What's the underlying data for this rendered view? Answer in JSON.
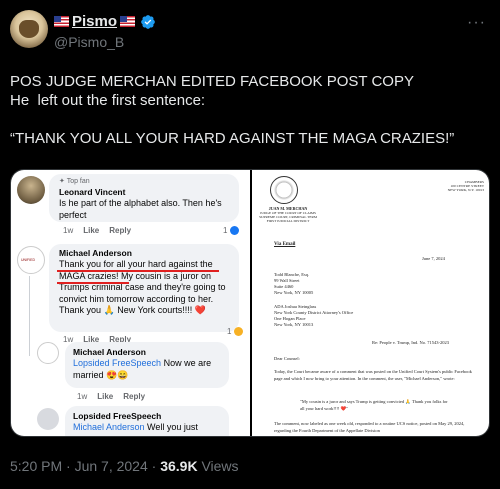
{
  "author": {
    "display_name": "Pismo",
    "handle": "@Pismo_B"
  },
  "more_label": "···",
  "post": {
    "line1": "POS JUDGE MERCHAN EDITED FACEBOOK POST COPY",
    "line2": "He  left out the first sentence:",
    "line3": "“THANK YOU ALL YOUR HARD AGAINST THE MAGA CRAZIES!”"
  },
  "facebook": {
    "comment1": {
      "badge": "Top fan",
      "author": "Leonard Vincent",
      "text": "Is he part of the alphabet also. Then he's perfect",
      "time": "1w",
      "like": "Like",
      "reply": "Reply",
      "count": "1"
    },
    "comment2": {
      "author": "Michael Anderson",
      "text": "Thank you for all your hard against the MAGA crazies! My cousin is a juror on Trumps criminal case and they're going to convict him tomorrow according to her. Thank you 🙏 New York courts!!!! ❤️",
      "time": "1w",
      "like": "Like",
      "reply": "Reply",
      "count": "1"
    },
    "comment3": {
      "author": "Michael Anderson",
      "mention": "Lopsided FreeSpeech",
      "text": " Now we are married 😍😄",
      "time": "1w",
      "like": "Like",
      "reply": "Reply"
    },
    "comment4": {
      "author": "Lopsided FreeSpeech",
      "mention": "Michael Anderson",
      "text": " Well you just"
    }
  },
  "letter": {
    "judge_name": "JUAN M. MERCHAN",
    "judge_title": "JUDGE OF THE COURT OF CLAIMS",
    "judge_sub1": "SUPREME COURT, CRIMINAL TERM",
    "judge_sub2": "FIRST JUDICIAL DISTRICT",
    "chambers": "CHAMBERS",
    "chambers_addr1": "100 CENTRE STREET",
    "chambers_addr2": "NEW YORK, N.Y. 10013",
    "via": "Via Email",
    "date": "June 7, 2024",
    "addr1_name": "Todd Blanche, Esq.",
    "addr1_l1": "99 Wall Street",
    "addr1_l2": "Suite 4460",
    "addr1_l3": "New York, NY 10005",
    "addr2_name": "ADA Joshua Steinglass",
    "addr2_l1": "New York County District Attorney's Office",
    "addr2_l2": "One Hogan Place",
    "addr2_l3": "New York, NY 10013",
    "re": "Re: People v. Trump, Ind. No. 71543-2023",
    "salutation": "Dear Counsel:",
    "body1": "Today, the Court became aware of a comment that was posted on the Unified Court System's public Facebook page and which I now bring to your attention. In the comment, the user, \"Michael Anderson,\" wrote:",
    "quote": "\"My cousin is a juror and says Trump is getting convicted 🙏 Thank you folks for all your hard work!!!! ❤️\"",
    "body2": "The comment, now labeled as one week old, responded to a routine UCS notice, posted on May 29, 2024, regarding the Fourth Department of the Appellate Division"
  },
  "footer": {
    "time": "5:20 PM · Jun 7, 2024 · ",
    "views_count": "36.9K",
    "views_label": " Views"
  }
}
